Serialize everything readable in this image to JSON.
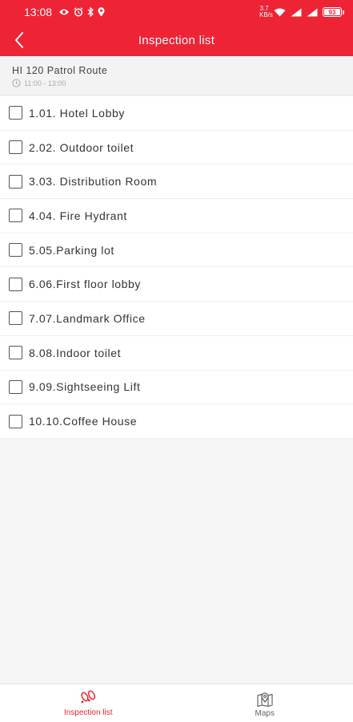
{
  "status_bar": {
    "time": "13:08",
    "network_speed": "3.7",
    "network_unit": "KB/s",
    "battery_level": "93"
  },
  "header": {
    "title": "Inspection list"
  },
  "route": {
    "name": "HI 120 Patrol Route",
    "time_range": "11:00 - 13:00"
  },
  "inspection_items": [
    {
      "label": "1.01. Hotel Lobby",
      "checked": false
    },
    {
      "label": "2.02. Outdoor toilet",
      "checked": false
    },
    {
      "label": "3.03. Distribution Room",
      "checked": false
    },
    {
      "label": "4.04. Fire Hydrant",
      "checked": false
    },
    {
      "label": "5.05.Parking lot",
      "checked": false
    },
    {
      "label": "6.06.First floor lobby",
      "checked": false
    },
    {
      "label": "7.07.Landmark Office",
      "checked": false
    },
    {
      "label": "8.08.Indoor toilet",
      "checked": false
    },
    {
      "label": "9.09.Sightseeing Lift",
      "checked": false
    },
    {
      "label": "10.10.Coffee House",
      "checked": false
    }
  ],
  "bottom_nav": {
    "tabs": [
      {
        "label": "Inspection list",
        "icon": "footprints-icon",
        "active": true
      },
      {
        "label": "Maps",
        "icon": "map-pin-icon",
        "active": false
      }
    ]
  },
  "colors": {
    "brand": "#ee2436",
    "text": "#333333",
    "muted": "#aaaaaa",
    "background": "#f5f5f5"
  }
}
